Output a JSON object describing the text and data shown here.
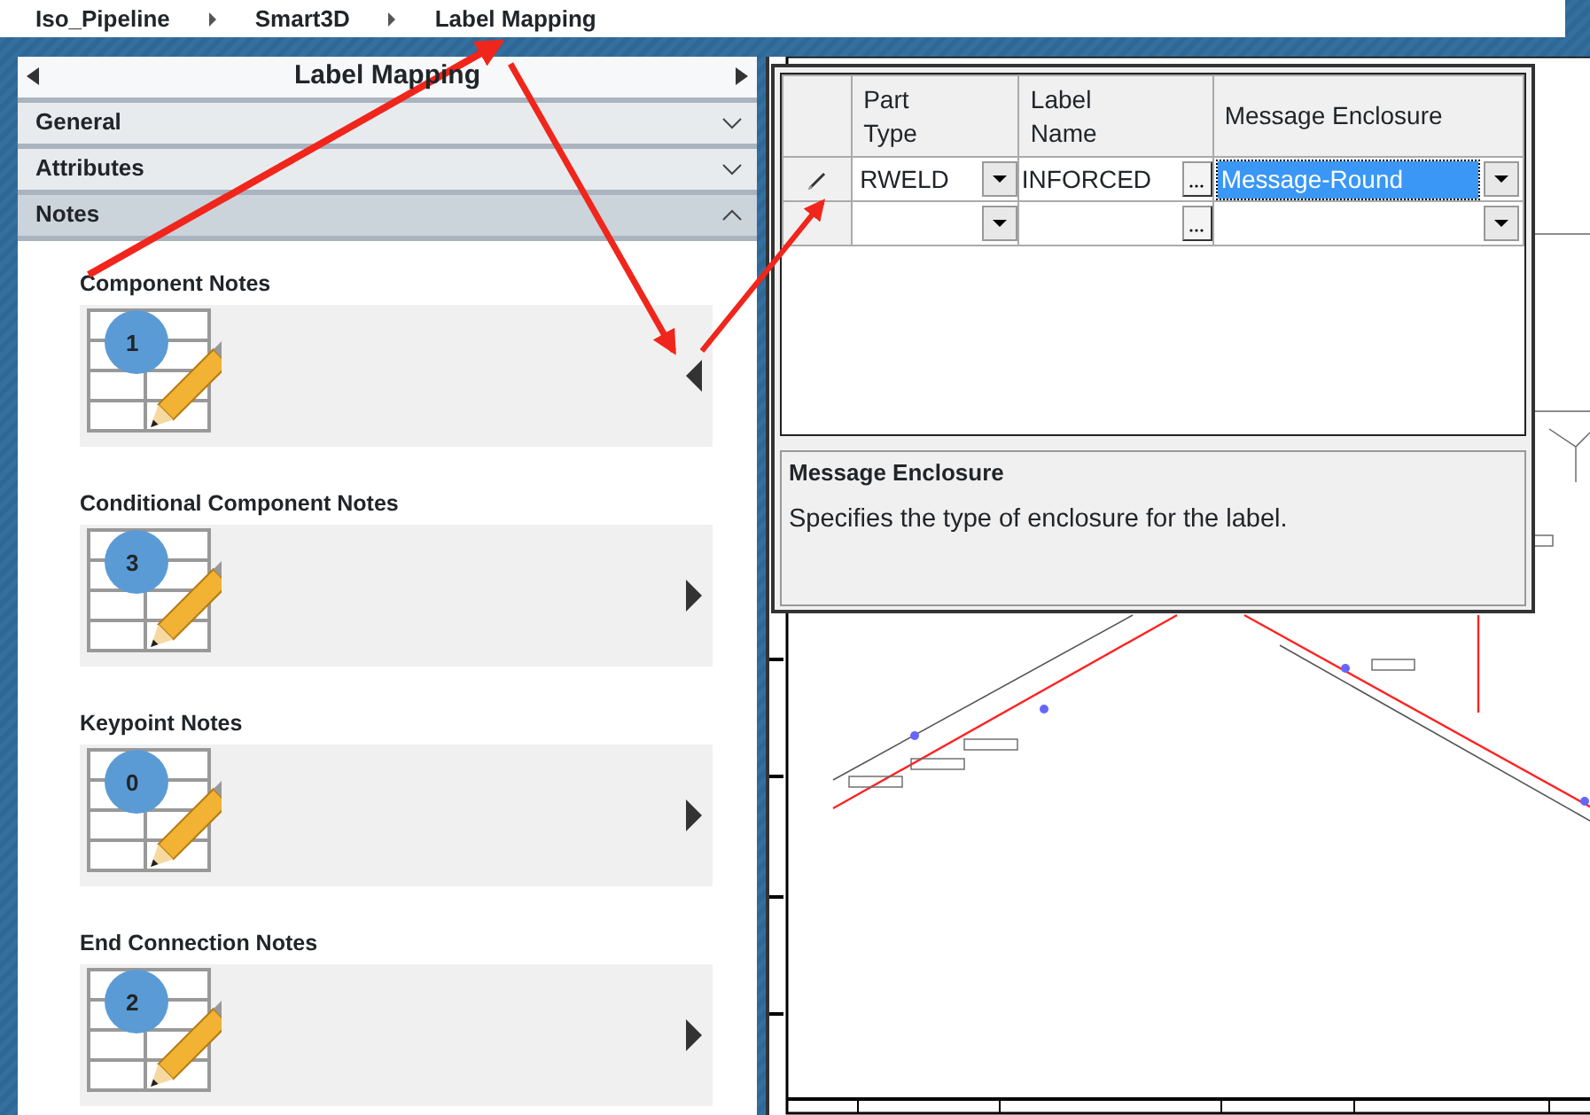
{
  "breadcrumb": [
    {
      "label": "Iso_Pipeline"
    },
    {
      "label": "Smart3D"
    },
    {
      "label": "Label Mapping"
    }
  ],
  "panel": {
    "title": "Label Mapping",
    "sections": [
      {
        "label": "General",
        "expanded": false
      },
      {
        "label": "Attributes",
        "expanded": false
      },
      {
        "label": "Notes",
        "expanded": true
      }
    ],
    "notes": [
      {
        "title": "Component Notes",
        "count": "1",
        "expanded": true
      },
      {
        "title": "Conditional Component Notes",
        "count": "3",
        "expanded": false
      },
      {
        "title": "Keypoint Notes",
        "count": "0",
        "expanded": false
      },
      {
        "title": "End Connection Notes",
        "count": "2",
        "expanded": false
      }
    ]
  },
  "grid": {
    "columns": [
      "Part Type",
      "Label Name",
      "Message Enclosure"
    ],
    "rows": [
      {
        "part_type": "RWELD",
        "label_name": "INFORCED",
        "enclosure": "Message-Round",
        "editing": true,
        "enclosure_selected": true
      },
      {
        "editing": false,
        "enclosure_selected": false
      }
    ]
  },
  "description": {
    "title": "Message Enclosure",
    "text": "Specifies the type of enclosure for the label."
  }
}
